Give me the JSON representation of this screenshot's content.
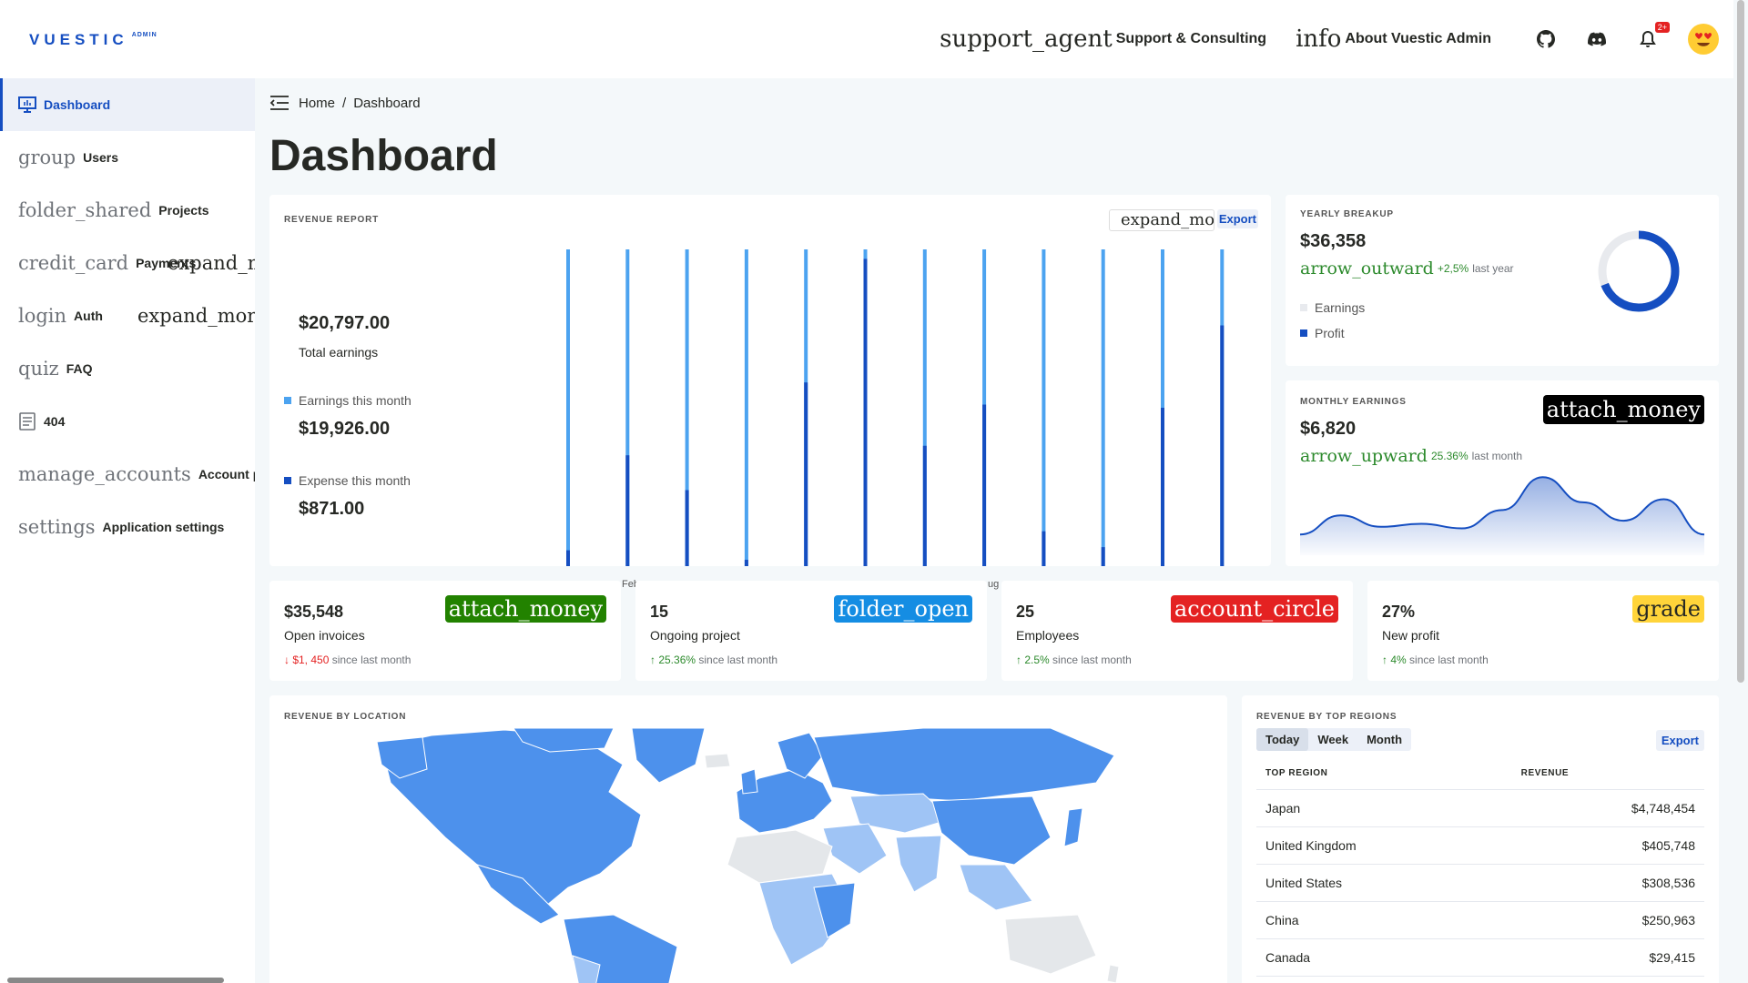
{
  "app": {
    "logo_word": "VUESTIC",
    "logo_sub": "ADMIN"
  },
  "topbar": {
    "support_icon": "support_agent",
    "support_label": "Support & Consulting",
    "about_icon": "info",
    "about_label": "About Vuestic Admin",
    "notification_badge": "2+",
    "icons": [
      "github-icon",
      "discord-icon",
      "bell-icon",
      "avatar-emoji"
    ]
  },
  "sidebar": {
    "items": [
      {
        "icon": "",
        "label": "Dashboard",
        "active": true
      },
      {
        "icon": "group",
        "label": "Users"
      },
      {
        "icon": "folder_shared",
        "label": "Projects"
      },
      {
        "icon": "credit_card",
        "label": "Payments",
        "expand": "expand_more"
      },
      {
        "icon": "login",
        "label": "Auth",
        "expand": "expand_more"
      },
      {
        "icon": "quiz",
        "label": "FAQ"
      },
      {
        "icon": "",
        "label": "404"
      },
      {
        "icon": "manage_accounts",
        "label": "Account preferences"
      },
      {
        "icon": "settings",
        "label": "Application settings"
      }
    ]
  },
  "breadcrumb": {
    "home": "Home",
    "sep": "/",
    "current": "Dashboard"
  },
  "page_title": "Dashboard",
  "revenue": {
    "title": "REVENUE REPORT",
    "select_text": "expand_more",
    "export_label": "Export",
    "total_value": "$20,797.00",
    "total_label": "Total earnings",
    "earnings_label": "Earnings this month",
    "earnings_value": "$19,926.00",
    "expense_label": "Expense this month",
    "expense_value": "$871.00",
    "earnings_color": "#4ca3f0",
    "expense_color": "#154ec1",
    "visible_axis_fragments": [
      "Feb",
      "ug"
    ]
  },
  "chart_data": {
    "type": "bar",
    "series": [
      {
        "values": [
          100,
          100,
          100,
          100,
          100,
          100,
          100,
          100,
          100,
          100,
          100,
          100
        ]
      },
      {
        "values": [
          5,
          35,
          24,
          2,
          58,
          97,
          38,
          51,
          11,
          6,
          50,
          76
        ]
      }
    ],
    "ylim": [
      0,
      100
    ],
    "stacking": "overlay",
    "colors": [
      "#4ca3f0",
      "#154ec1"
    ]
  },
  "yearly": {
    "title": "YEARLY BREAKUP",
    "value": "$36,358",
    "trend_icon": "arrow_outward",
    "trend_value": "+2,5%",
    "trend_text": "last year",
    "legend_earnings": "Earnings",
    "legend_profit": "Profit",
    "earnings_color": "#e8eaee",
    "profit_color": "#154ec1",
    "donut": {
      "profit_fraction": 0.69
    }
  },
  "monthly": {
    "title": "MONTHLY EARNINGS",
    "value": "$6,820",
    "chip_icon": "attach_money",
    "trend_icon": "arrow_upward",
    "trend_value": "25.36%",
    "trend_text": "last month",
    "line_color": "#154ec1",
    "sparkline": [
      20,
      45,
      30,
      34,
      28,
      52,
      95,
      62,
      38,
      66,
      20
    ]
  },
  "stats": [
    {
      "value": "$35,548",
      "label": "Open invoices",
      "change": "↓ $1, 450",
      "change_text": "since last month",
      "direction": "down",
      "chip": "attach_money",
      "chip_bg": "#228200",
      "chip_fg": "#ffffff"
    },
    {
      "value": "15",
      "label": "Ongoing project",
      "change": "↑ 25.36%",
      "change_text": "since last month",
      "direction": "up",
      "chip": "folder_open",
      "chip_bg": "#158de3",
      "chip_fg": "#ffffff"
    },
    {
      "value": "25",
      "label": "Employees",
      "change": "↑ 2.5%",
      "change_text": "since last month",
      "direction": "up",
      "chip": "account_circle",
      "chip_bg": "#e42222",
      "chip_fg": "#ffffff"
    },
    {
      "value": "27%",
      "label": "New profit",
      "change": "↑ 4%",
      "change_text": "since last month",
      "direction": "up",
      "chip": "grade",
      "chip_bg": "#ffd43a",
      "chip_fg": "#262824"
    }
  ],
  "map": {
    "title": "REVENUE BY LOCATION",
    "land_color": "#4d91ec",
    "light_color": "#9fc4f5",
    "empty_color": "#e4e7ea"
  },
  "regions": {
    "title": "REVENUE BY TOP REGIONS",
    "tabs": [
      "Today",
      "Week",
      "Month"
    ],
    "export_label": "Export",
    "col_region": "TOP REGION",
    "col_revenue": "REVENUE",
    "rows": [
      {
        "name": "Japan",
        "revenue": "$4,748,454"
      },
      {
        "name": "United Kingdom",
        "revenue": "$405,748"
      },
      {
        "name": "United States",
        "revenue": "$308,536"
      },
      {
        "name": "China",
        "revenue": "$250,963"
      },
      {
        "name": "Canada",
        "revenue": "$29,415"
      }
    ]
  }
}
